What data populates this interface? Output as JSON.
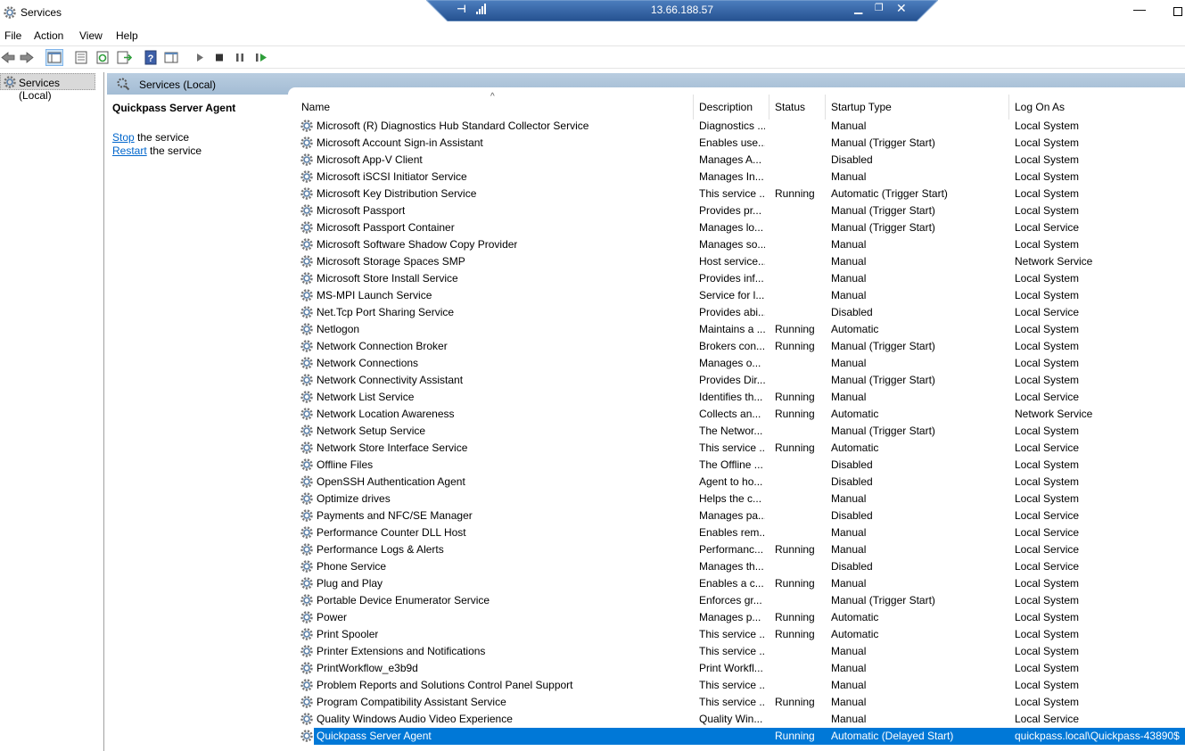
{
  "window": {
    "title": "Services",
    "icon": "gear-icon"
  },
  "rdp": {
    "host": "13.66.188.57"
  },
  "menu": [
    "File",
    "Action",
    "View",
    "Help"
  ],
  "tree": {
    "root_label": "Services (Local)"
  },
  "pane": {
    "header": "Services (Local)",
    "selected_service": "Quickpass Server Agent",
    "stop_link": "Stop",
    "stop_suffix": " the service",
    "restart_link": "Restart",
    "restart_suffix": " the service"
  },
  "columns": {
    "name": "Name",
    "description": "Description",
    "status": "Status",
    "startup": "Startup Type",
    "logon": "Log On As"
  },
  "rows": [
    {
      "name": "Microsoft (R) Diagnostics Hub Standard Collector Service",
      "description": "Diagnostics ...",
      "status": "",
      "startup": "Manual",
      "logon": "Local System"
    },
    {
      "name": "Microsoft Account Sign-in Assistant",
      "description": "Enables use...",
      "status": "",
      "startup": "Manual (Trigger Start)",
      "logon": "Local System"
    },
    {
      "name": "Microsoft App-V Client",
      "description": "Manages A...",
      "status": "",
      "startup": "Disabled",
      "logon": "Local System"
    },
    {
      "name": "Microsoft iSCSI Initiator Service",
      "description": "Manages In...",
      "status": "",
      "startup": "Manual",
      "logon": "Local System"
    },
    {
      "name": "Microsoft Key Distribution Service",
      "description": "This service ...",
      "status": "Running",
      "startup": "Automatic (Trigger Start)",
      "logon": "Local System"
    },
    {
      "name": "Microsoft Passport",
      "description": "Provides pr...",
      "status": "",
      "startup": "Manual (Trigger Start)",
      "logon": "Local System"
    },
    {
      "name": "Microsoft Passport Container",
      "description": "Manages lo...",
      "status": "",
      "startup": "Manual (Trigger Start)",
      "logon": "Local Service"
    },
    {
      "name": "Microsoft Software Shadow Copy Provider",
      "description": "Manages so...",
      "status": "",
      "startup": "Manual",
      "logon": "Local System"
    },
    {
      "name": "Microsoft Storage Spaces SMP",
      "description": "Host service...",
      "status": "",
      "startup": "Manual",
      "logon": "Network Service"
    },
    {
      "name": "Microsoft Store Install Service",
      "description": "Provides inf...",
      "status": "",
      "startup": "Manual",
      "logon": "Local System"
    },
    {
      "name": "MS-MPI Launch Service",
      "description": "Service for l...",
      "status": "",
      "startup": "Manual",
      "logon": "Local System"
    },
    {
      "name": "Net.Tcp Port Sharing Service",
      "description": "Provides abi...",
      "status": "",
      "startup": "Disabled",
      "logon": "Local Service"
    },
    {
      "name": "Netlogon",
      "description": "Maintains a ...",
      "status": "Running",
      "startup": "Automatic",
      "logon": "Local System"
    },
    {
      "name": "Network Connection Broker",
      "description": "Brokers con...",
      "status": "Running",
      "startup": "Manual (Trigger Start)",
      "logon": "Local System"
    },
    {
      "name": "Network Connections",
      "description": "Manages o...",
      "status": "",
      "startup": "Manual",
      "logon": "Local System"
    },
    {
      "name": "Network Connectivity Assistant",
      "description": "Provides Dir...",
      "status": "",
      "startup": "Manual (Trigger Start)",
      "logon": "Local System"
    },
    {
      "name": "Network List Service",
      "description": "Identifies th...",
      "status": "Running",
      "startup": "Manual",
      "logon": "Local Service"
    },
    {
      "name": "Network Location Awareness",
      "description": "Collects an...",
      "status": "Running",
      "startup": "Automatic",
      "logon": "Network Service"
    },
    {
      "name": "Network Setup Service",
      "description": "The Networ...",
      "status": "",
      "startup": "Manual (Trigger Start)",
      "logon": "Local System"
    },
    {
      "name": "Network Store Interface Service",
      "description": "This service ...",
      "status": "Running",
      "startup": "Automatic",
      "logon": "Local Service"
    },
    {
      "name": "Offline Files",
      "description": "The Offline ...",
      "status": "",
      "startup": "Disabled",
      "logon": "Local System"
    },
    {
      "name": "OpenSSH Authentication Agent",
      "description": "Agent to ho...",
      "status": "",
      "startup": "Disabled",
      "logon": "Local System"
    },
    {
      "name": "Optimize drives",
      "description": "Helps the c...",
      "status": "",
      "startup": "Manual",
      "logon": "Local System"
    },
    {
      "name": "Payments and NFC/SE Manager",
      "description": "Manages pa...",
      "status": "",
      "startup": "Disabled",
      "logon": "Local Service"
    },
    {
      "name": "Performance Counter DLL Host",
      "description": "Enables rem...",
      "status": "",
      "startup": "Manual",
      "logon": "Local Service"
    },
    {
      "name": "Performance Logs & Alerts",
      "description": "Performanc...",
      "status": "Running",
      "startup": "Manual",
      "logon": "Local Service"
    },
    {
      "name": "Phone Service",
      "description": "Manages th...",
      "status": "",
      "startup": "Disabled",
      "logon": "Local Service"
    },
    {
      "name": "Plug and Play",
      "description": "Enables a c...",
      "status": "Running",
      "startup": "Manual",
      "logon": "Local System"
    },
    {
      "name": "Portable Device Enumerator Service",
      "description": "Enforces gr...",
      "status": "",
      "startup": "Manual (Trigger Start)",
      "logon": "Local System"
    },
    {
      "name": "Power",
      "description": "Manages p...",
      "status": "Running",
      "startup": "Automatic",
      "logon": "Local System"
    },
    {
      "name": "Print Spooler",
      "description": "This service ...",
      "status": "Running",
      "startup": "Automatic",
      "logon": "Local System"
    },
    {
      "name": "Printer Extensions and Notifications",
      "description": "This service ...",
      "status": "",
      "startup": "Manual",
      "logon": "Local System"
    },
    {
      "name": "PrintWorkflow_e3b9d",
      "description": "Print Workfl...",
      "status": "",
      "startup": "Manual",
      "logon": "Local System"
    },
    {
      "name": "Problem Reports and Solutions Control Panel Support",
      "description": "This service ...",
      "status": "",
      "startup": "Manual",
      "logon": "Local System"
    },
    {
      "name": "Program Compatibility Assistant Service",
      "description": "This service ...",
      "status": "Running",
      "startup": "Manual",
      "logon": "Local System"
    },
    {
      "name": "Quality Windows Audio Video Experience",
      "description": "Quality Win...",
      "status": "",
      "startup": "Manual",
      "logon": "Local Service"
    },
    {
      "name": "Quickpass Server Agent",
      "description": "",
      "status": "Running",
      "startup": "Automatic (Delayed Start)",
      "logon": "quickpass.local\\Quickpass-43890$",
      "selected": true
    }
  ]
}
